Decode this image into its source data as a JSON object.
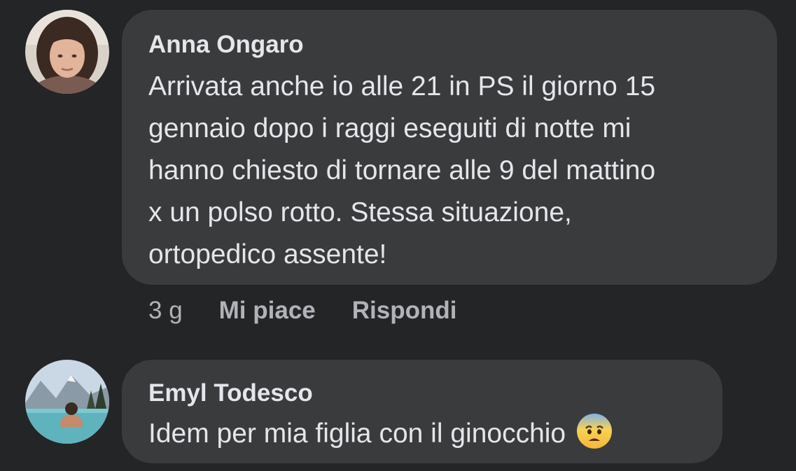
{
  "comments": [
    {
      "author": "Anna Ongaro",
      "avatar_icon": "user-avatar-photo",
      "lines": [
        "Arrivata anche io alle 21 in PS il giorno 15",
        "gennaio dopo i raggi eseguiti di notte mi",
        "hanno chiesto di tornare alle 9 del mattino",
        "x un polso rotto. Stessa situazione,",
        "ortopedico assente!"
      ],
      "time": "3 g",
      "like_label": "Mi piace",
      "reply_label": "Rispondi"
    },
    {
      "author": "Emyl Todesco",
      "avatar_icon": "user-avatar-photo",
      "text": "Idem per mia figlia con il ginocchio",
      "emoji_icon": "anxious-face-with-sweat-emoji"
    }
  ],
  "colors": {
    "background": "#242526",
    "bubble": "#3a3b3c",
    "primary_text": "#e4e6eb",
    "secondary_text": "#b0b3b8"
  }
}
